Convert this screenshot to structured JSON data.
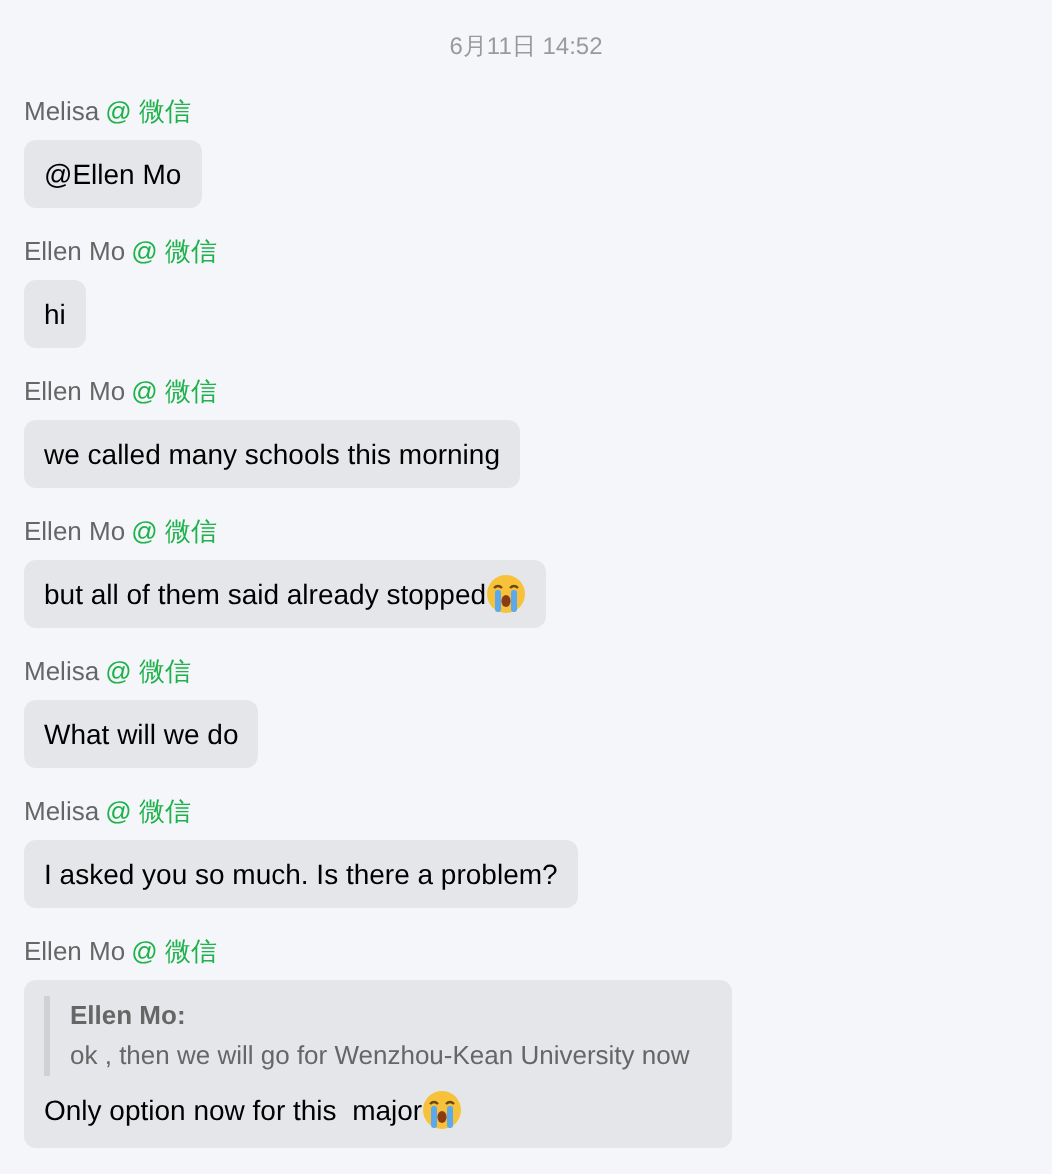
{
  "timestamp": "6月11日 14:52",
  "messages": [
    {
      "sender": "Melisa",
      "source": "@ 微信",
      "text": "@Ellen Mo",
      "crying_emoji": false
    },
    {
      "sender": "Ellen Mo",
      "source": "@ 微信",
      "text": "hi",
      "crying_emoji": false
    },
    {
      "sender": "Ellen Mo",
      "source": "@ 微信",
      "text": "we called many schools this morning",
      "crying_emoji": false
    },
    {
      "sender": "Ellen Mo",
      "source": "@ 微信",
      "text": "but all of them said already stopped",
      "crying_emoji": true
    },
    {
      "sender": "Melisa",
      "source": "@ 微信",
      "text": "What will we do",
      "crying_emoji": false
    },
    {
      "sender": "Melisa",
      "source": "@ 微信",
      "text": "I asked you so much. Is there a problem?",
      "crying_emoji": false
    },
    {
      "sender": "Ellen Mo",
      "source": "@ 微信",
      "quote": {
        "author": "Ellen Mo:",
        "text": "ok , then we will go for Wenzhou-Kean University now"
      },
      "text": "Only option now for this  major",
      "crying_emoji": true
    }
  ]
}
